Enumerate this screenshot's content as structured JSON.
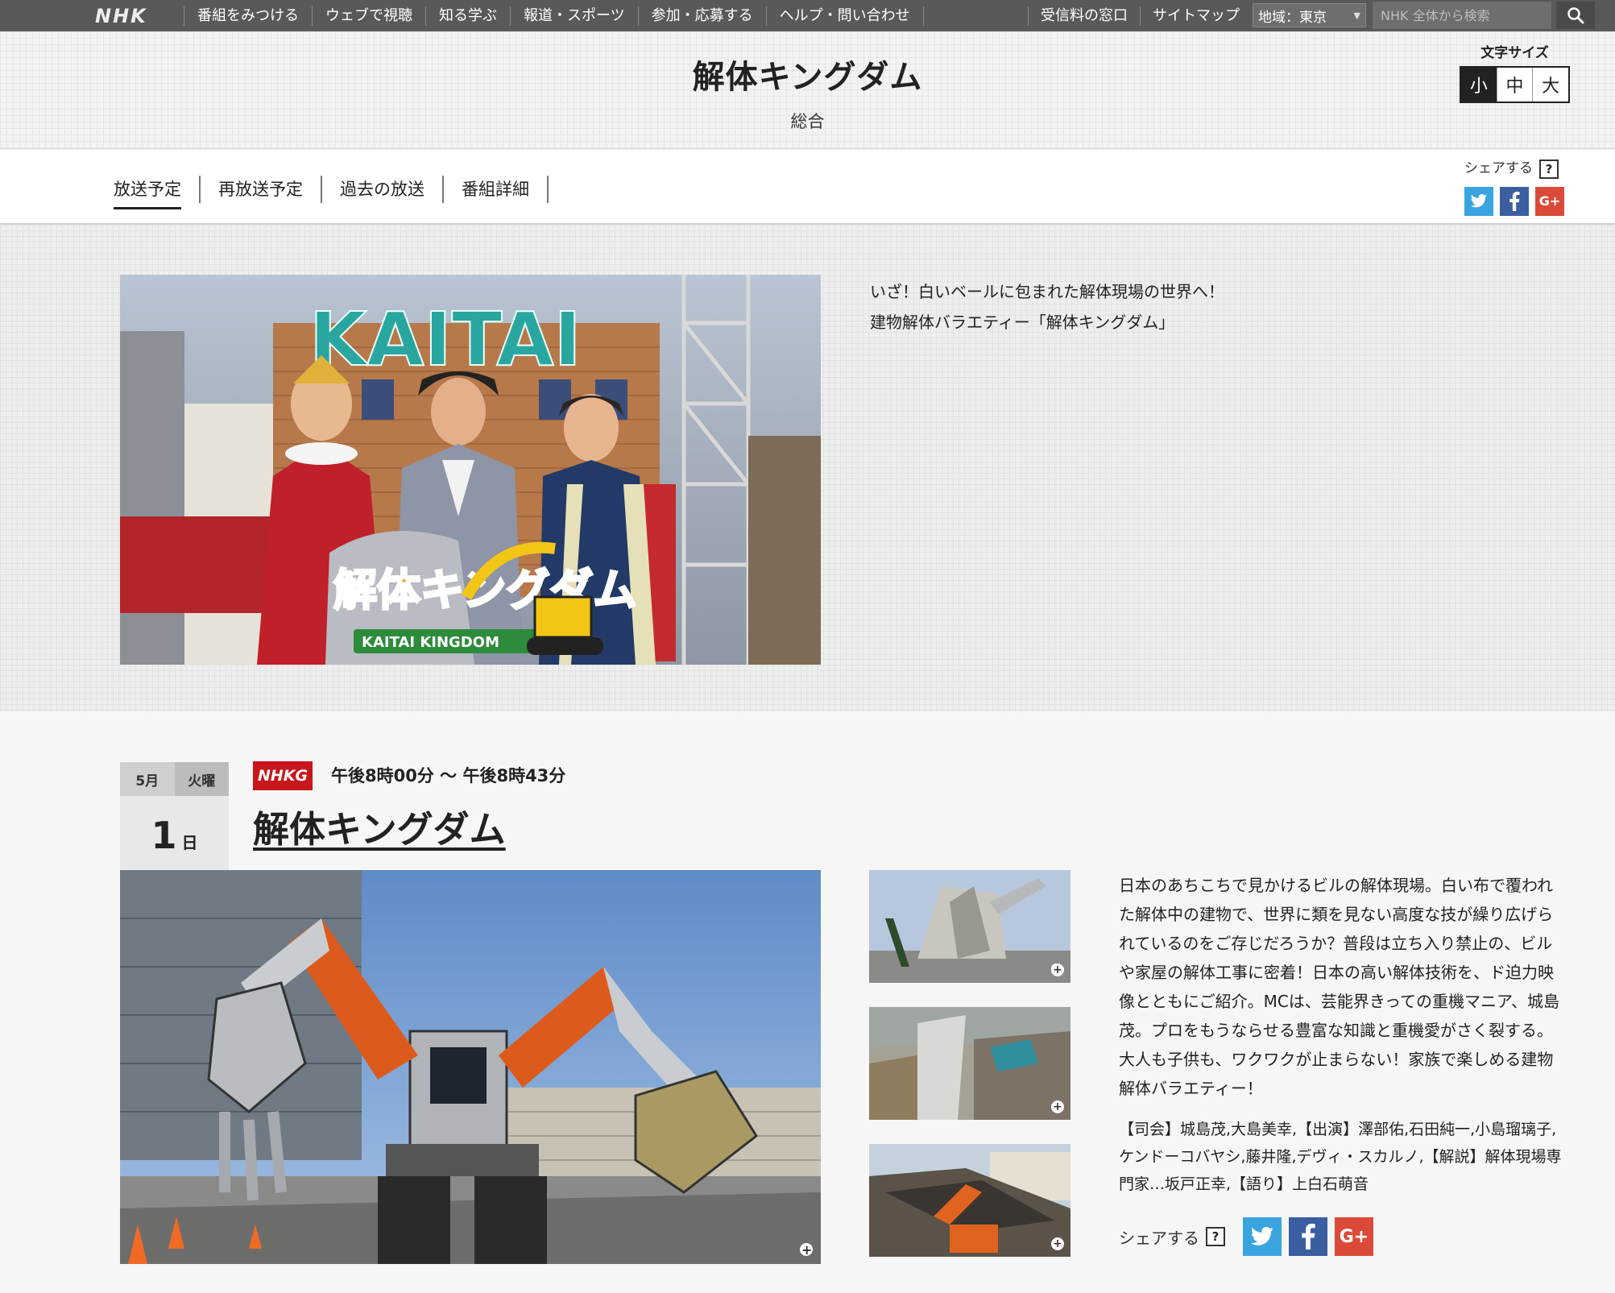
{
  "global_nav": {
    "logo": "NHK",
    "items": [
      "番組をみつける",
      "ウェブで視聴",
      "知る学ぶ",
      "報道・スポーツ",
      "参加・応募する",
      "ヘルプ・問い合わせ"
    ],
    "right_links": [
      "受信料の窓口",
      "サイトマップ"
    ],
    "region_label": "地域：東京",
    "search_placeholder": "NHK 全体から検索"
  },
  "header": {
    "title": "解体キングダム",
    "channel": "総合",
    "font_size": {
      "label": "文字サイズ",
      "options": [
        "小",
        "中",
        "大"
      ],
      "selected": "小"
    }
  },
  "tabs": {
    "items": [
      "放送予定",
      "再放送予定",
      "過去の放送",
      "番組詳細"
    ],
    "active": "放送予定"
  },
  "share": {
    "label": "シェアする",
    "help": "?"
  },
  "hero": {
    "lines": [
      "いざ！白いベールに包まれた解体現場の世界へ！",
      "建物解体バラエティー「解体キングダム」"
    ],
    "image_logo_main": "解体キングダム",
    "image_logo_sub": "KAITAI KINGDOM",
    "image_sign": "KAITAI"
  },
  "episode": {
    "month": "5月",
    "weekday": "火曜",
    "day": "1",
    "day_suffix": "日",
    "channel_badge": "NHKG",
    "time": "午後8時00分 〜 午後8時43分",
    "title": "解体キングダム",
    "description": "日本のあちこちで見かけるビルの解体現場。白い布で覆われた解体中の建物で、世界に類を見ない高度な技が繰り広げられているのをご存じだろうか？普段は立ち入り禁止の、ビルや家屋の解体工事に密着！日本の高い解体技術を、ド迫力映像とともにご紹介。MCは、芸能界きっての重機マニア、城島茂。プロをもうならせる豊富な知識と重機愛がさく裂する。大人も子供も、ワクワクが止まらない！家族で楽しめる建物解体バラエティー！",
    "cast": "【司会】城島茂,大島美幸,【出演】澤部佑,石田純一,小島瑠璃子,ケンドーコバヤシ,藤井隆,デヴィ・スカルノ,【解説】解体現場専門家…坂戸正幸,【語り】上白石萌音"
  },
  "colors": {
    "global_bar": "#595959",
    "nhk_red": "#c8161d",
    "twitter": "#3aa4e0",
    "facebook": "#3b5ea0",
    "google_plus": "#db4a39"
  }
}
